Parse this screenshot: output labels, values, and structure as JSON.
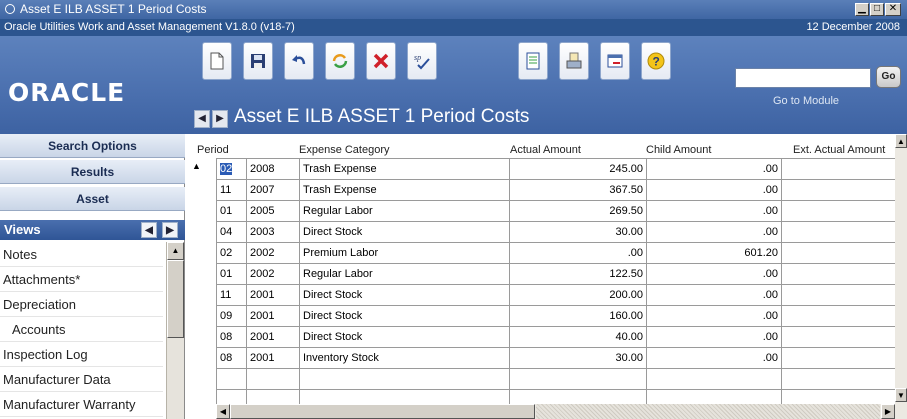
{
  "window": {
    "title": "Asset E ILB ASSET 1 Period Costs",
    "version": "Oracle Utilities Work and Asset Management V1.8.0 (v18-7)",
    "date": "12 December  2008"
  },
  "header": {
    "logo": "ORACLE",
    "page_title": "Asset E ILB ASSET 1 Period Costs",
    "goto_label": "Go to Module",
    "go_button": "Go",
    "goto_value": ""
  },
  "toolbar": {
    "icons": [
      "new-document-icon",
      "save-icon",
      "undo-icon",
      "refresh-icon",
      "delete-icon",
      "spell-check-icon",
      "report-icon",
      "print-icon",
      "export-icon",
      "help-icon"
    ],
    "spell_label": "sp"
  },
  "sidebar": {
    "search_options": "Search Options",
    "results": "Results",
    "asset": "Asset",
    "views_label": "Views",
    "items": [
      "Notes",
      "Attachments*",
      "Depreciation",
      "Accounts",
      "Inspection Log",
      "Manufacturer Data",
      "Manufacturer Warranty"
    ]
  },
  "grid": {
    "columns": [
      "Period",
      "Expense Category",
      "Actual Amount",
      "Child Amount",
      "Ext. Actual Amount"
    ],
    "rows": [
      {
        "period": "02",
        "year": "2008",
        "category": "Trash Expense",
        "actual": "245.00",
        "child": ".00"
      },
      {
        "period": "11",
        "year": "2007",
        "category": "Trash Expense",
        "actual": "367.50",
        "child": ".00"
      },
      {
        "period": "01",
        "year": "2005",
        "category": "Regular Labor",
        "actual": "269.50",
        "child": ".00"
      },
      {
        "period": "04",
        "year": "2003",
        "category": "Direct Stock",
        "actual": "30.00",
        "child": ".00"
      },
      {
        "period": "02",
        "year": "2002",
        "category": "Premium Labor",
        "actual": ".00",
        "child": "601.20"
      },
      {
        "period": "01",
        "year": "2002",
        "category": "Regular Labor",
        "actual": "122.50",
        "child": ".00"
      },
      {
        "period": "11",
        "year": "2001",
        "category": "Direct Stock",
        "actual": "200.00",
        "child": ".00"
      },
      {
        "period": "09",
        "year": "2001",
        "category": "Direct Stock",
        "actual": "160.00",
        "child": ".00"
      },
      {
        "period": "08",
        "year": "2001",
        "category": "Direct Stock",
        "actual": "40.00",
        "child": ".00"
      },
      {
        "period": "08",
        "year": "2001",
        "category": "Inventory Stock",
        "actual": "30.00",
        "child": ".00"
      },
      {
        "period": "",
        "year": "",
        "category": "",
        "actual": "",
        "child": ""
      },
      {
        "period": "",
        "year": "",
        "category": "",
        "actual": "",
        "child": ""
      }
    ]
  },
  "colors": {
    "titlebar": "#4a6fae",
    "header": "#4a6fae",
    "selection": "#2a5bb5"
  }
}
